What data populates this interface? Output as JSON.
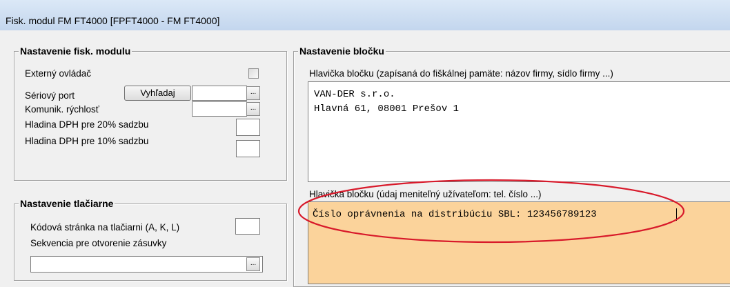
{
  "window": {
    "title": "Fisk. modul  FM FT4000   [FPFT4000 - FM FT4000]"
  },
  "fisk_module_group": {
    "title": "Nastavenie fisk. modulu",
    "external_controller_label": "Externý ovládač",
    "serial_port_label": "Sériový port",
    "search_button_label": "Vyhľadaj",
    "comm_speed_label": "Komunik. rýchlosť",
    "vat_20_label": "Hladina DPH pre 20% sadzbu",
    "vat_10_label": "Hladina DPH pre 10% sadzbu",
    "ellipsis": "..."
  },
  "printer_group": {
    "title": "Nastavenie tlačiarne",
    "code_page_label": "Kódová stránka na tlačiarni (A, K, L)",
    "drawer_sequence_label": "Sekvencia pre otvorenie zásuvky",
    "ellipsis": "..."
  },
  "receipt_group": {
    "title": "Nastavenie bločku",
    "header_label": "Hlavička bločku (zapísaná do fiškálnej pamäte: názov firmy, sídlo firmy ...)",
    "header_lines": [
      "VAN-DER s.r.o.",
      "Hlavná 61, 08001 Prešov 1"
    ],
    "editable_header_label": "Hlavička bločku (údaj meniteľný užívateľom: tel. číslo ...)",
    "editable_header_value": "Číslo oprávnenia na distribúciu SBL: 123456789123"
  },
  "colors": {
    "highlight_memo": "#fbd39b",
    "annotation_ellipse": "#d8192a"
  }
}
